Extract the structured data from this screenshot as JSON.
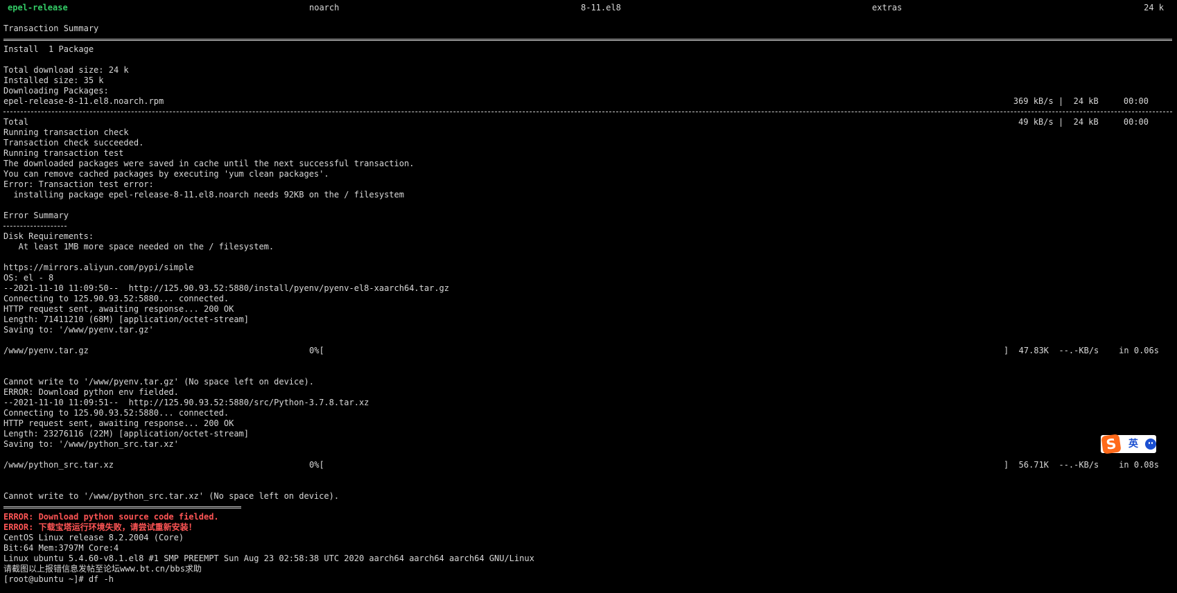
{
  "pkg_row": {
    "name": "epel-release",
    "arch": "noarch",
    "version": "8-11.el8",
    "repo": "extras",
    "size": "24 k"
  },
  "transaction_summary": "Transaction Summary",
  "install_line": "Install  1 Package",
  "total_download": "Total download size: 24 k",
  "installed_size": "Installed size: 35 k",
  "downloading": "Downloading Packages:",
  "rpm_file": "epel-release-8-11.el8.noarch.rpm",
  "rpm_stats": "369 kB/s |  24 kB     00:00",
  "total_label": "Total",
  "total_stats": " 49 kB/s |  24 kB     00:00",
  "tx_lines": [
    "Running transaction check",
    "Transaction check succeeded.",
    "Running transaction test",
    "The downloaded packages were saved in cache until the next successful transaction.",
    "You can remove cached packages by executing 'yum clean packages'.",
    "Error: Transaction test error:",
    "  installing package epel-release-8-11.el8.noarch needs 92KB on the / filesystem"
  ],
  "error_summary": "Error Summary",
  "disk_lines": [
    "Disk Requirements:",
    "   At least 1MB more space needed on the / filesystem."
  ],
  "pyenv_lines": [
    "https://mirrors.aliyun.com/pypi/simple",
    "OS: el - 8",
    "--2021-11-10 11:09:50--  http://125.90.93.52:5880/install/pyenv/pyenv-el8-xaarch64.tar.gz",
    "Connecting to 125.90.93.52:5880... connected.",
    "HTTP request sent, awaiting response... 200 OK",
    "Length: 71411210 (68M) [application/octet-stream]",
    "Saving to: '/www/pyenv.tar.gz'"
  ],
  "progress1": {
    "name": "/www/pyenv.tar.gz",
    "pct": "0%[",
    "end": "]  47.83K  --.-KB/s    in 0.06s"
  },
  "python_lines": [
    "Cannot write to '/www/pyenv.tar.gz' (No space left on device).",
    "ERROR: Download python env fielded.",
    "--2021-11-10 11:09:51--  http://125.90.93.52:5880/src/Python-3.7.8.tar.xz",
    "Connecting to 125.90.93.52:5880... connected.",
    "HTTP request sent, awaiting response... 200 OK",
    "Length: 23276116 (22M) [application/octet-stream]",
    "Saving to: '/www/python_src.tar.xz'"
  ],
  "progress2": {
    "name": "/www/python_src.tar.xz",
    "pct": "0%[",
    "end": "]  56.71K  --.-KB/s    in 0.08s"
  },
  "cannot_write_src": "Cannot write to '/www/python_src.tar.xz' (No space left on device).",
  "red_lines": [
    "ERROR: Download python source code fielded.",
    "ERROR: 下载宝塔运行环境失败，请尝试重新安装！"
  ],
  "sys_lines": [
    "CentOS Linux release 8.2.2004 (Core)",
    "Bit:64 Mem:3797M Core:4",
    "Linux ubuntu 5.4.60-v8.1.el8 #1 SMP PREEMPT Sun Aug 23 02:58:38 UTC 2020 aarch64 aarch64 aarch64 GNU/Linux",
    "请截图以上报错信息发帖至论坛www.bt.cn/bbs求助"
  ],
  "prompt": "[root@ubuntu ~]# df -h",
  "ime": {
    "logo": "S",
    "lang": "英",
    "icon": "smiley-icon"
  },
  "colors": {
    "background": "#000000",
    "text": "#d9d9d9",
    "green": "#33cc66",
    "red": "#ff5555",
    "ime_orange": "#ff6a1a",
    "ime_blue": "#1a4fd1"
  }
}
